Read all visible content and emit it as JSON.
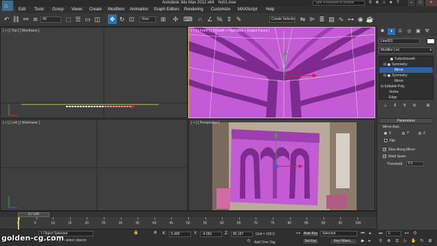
{
  "window": {
    "title": "Autodesk 3ds Max  2012 x64",
    "file": "hs01.max",
    "search_placeholder": "Type a keyword or phrase",
    "app_logo": "3ds-max-logo",
    "controls": [
      "–",
      "□",
      "×"
    ]
  },
  "menus": [
    "Edit",
    "Tools",
    "Group",
    "Views",
    "Create",
    "Modifiers",
    "Animation",
    "Graph Editors",
    "Rendering",
    "Customize",
    "MAXScript",
    "Help"
  ],
  "toolbar": {
    "filter_value": "All",
    "refcoord_value": "View",
    "selection_set_value": "Create Selection Se",
    "icons": [
      "undo-icon",
      "redo-icon",
      "link-icon",
      "unlink-icon",
      "bind-space-warp-icon",
      "select-object-icon",
      "select-by-name-icon",
      "rect-selection-icon",
      "window-crossing-icon",
      "select-move-icon",
      "select-rotate-icon",
      "select-scale-icon",
      "pivot-center-icon",
      "select-manipulate-icon",
      "snaps-toggle-icon",
      "angle-snap-icon",
      "percent-snap-icon",
      "spinner-snap-icon",
      "mirror-icon",
      "align-icon",
      "layer-manager-icon",
      "graphite-ribbon-icon",
      "curve-editor-icon",
      "schematic-view-icon",
      "material-editor-icon",
      "render-setup-icon",
      "rendered-frame-icon",
      "render-icon"
    ]
  },
  "viewports": {
    "top": {
      "label": "[ + ] [ Top ] [ Wireframe ]"
    },
    "front": {
      "label": "[ + ] [ Front ] [ Smooth + Highlights + Edged Faces ]"
    },
    "left": {
      "label": "[ + ] [ Left ] [ Wireframe ]"
    },
    "perspective": {
      "label": "[ + ] [ Perspective ]"
    }
  },
  "command_panel": {
    "tabs": [
      "create-tab-icon",
      "modify-tab-icon",
      "hierarchy-tab-icon",
      "motion-tab-icon",
      "display-tab-icon",
      "utilities-tab-icon"
    ],
    "object_name": "Line001",
    "object_color": "#ffffff",
    "modifier_list": "Modifier List",
    "stack": [
      {
        "label": "TurboSmooth",
        "indent": 1,
        "selected": false
      },
      {
        "label": "Symmetry",
        "indent": 1,
        "selected": false
      },
      {
        "label": "Mirror",
        "indent": 2,
        "selected": true
      },
      {
        "label": "Symmetry",
        "indent": 1,
        "selected": false
      },
      {
        "label": "Mirror",
        "indent": 2,
        "selected": false
      },
      {
        "label": "Editable Poly",
        "indent": 0,
        "selected": false
      },
      {
        "label": "Vertex",
        "indent": 1,
        "selected": false
      },
      {
        "label": "Edge",
        "indent": 1,
        "selected": false
      }
    ],
    "stack_buttons": [
      "pin-stack-icon",
      "show-end-result-icon",
      "make-unique-icon",
      "remove-modifier-icon",
      "configure-sets-icon"
    ],
    "parameters": {
      "title": "Parameters",
      "mirror_axis_label": "Mirror Axis:",
      "axes": [
        "X",
        "Y",
        "Z"
      ],
      "selected_axis": "X",
      "flip_label": "Flip",
      "flip": false,
      "slice_label": "Slice Along Mirror",
      "slice": true,
      "weld_label": "Weld Seam",
      "weld": true,
      "threshold_label": "Threshold:",
      "threshold_value": "0.1"
    }
  },
  "timeline": {
    "position": "0 / 100",
    "ticks": [
      "0",
      "5",
      "10",
      "15",
      "20",
      "25",
      "30",
      "35",
      "40",
      "45",
      "50",
      "55",
      "60",
      "65",
      "70",
      "75",
      "80",
      "85",
      "90",
      "95",
      "100"
    ]
  },
  "status": {
    "selection": "1 Object Selected",
    "prompt": "Click-and-drag to select objects",
    "x_label": "X:",
    "x_value": "5.489",
    "y_label": "Y:",
    "y_value": "-4.056",
    "z_label": "Z:",
    "z_value": "85.187",
    "grid": "Grid = 100.0",
    "add_time_tag": "Add Time Tag",
    "auto_key": "Auto Key",
    "set_key": "Set Key",
    "selected_value": "Selected",
    "key_filters": "Key Filters...",
    "frame_value": "0"
  },
  "watermark": "golden-cg.com",
  "colors": {
    "accent": "#2e6fb0",
    "mesh_magenta": "#c95ad6",
    "mesh_dark": "#7a2a8c",
    "active_border": "#e8c44a"
  }
}
